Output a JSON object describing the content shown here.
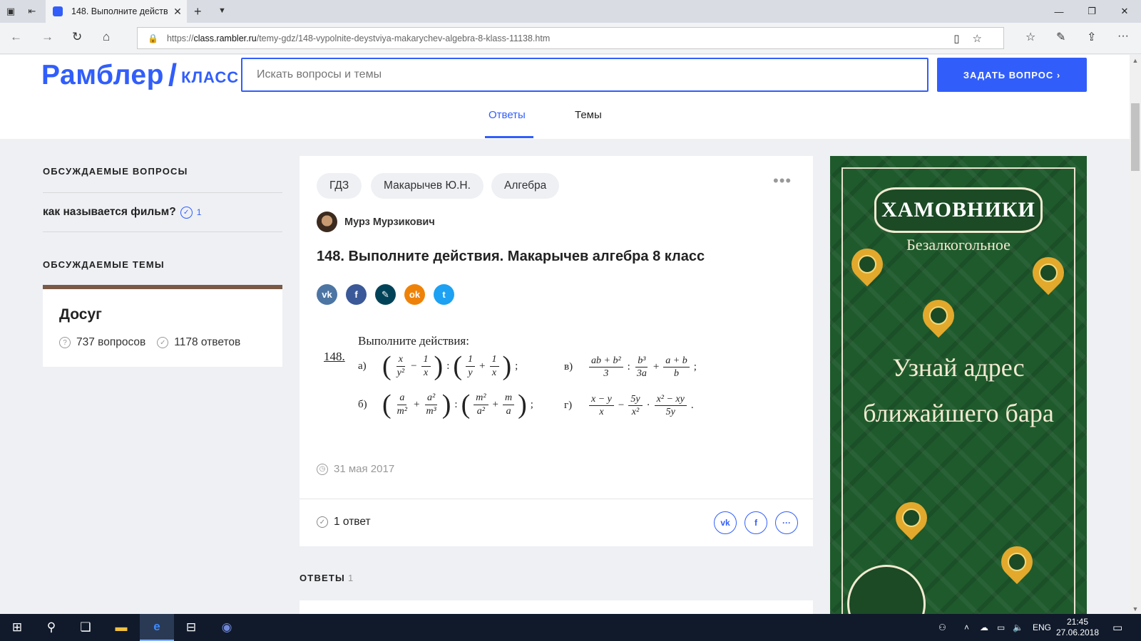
{
  "browser": {
    "tab_title": "148. Выполните действ",
    "url_prefix": "https://",
    "url_host": "class.rambler.ru",
    "url_path": "/temy-gdz/148-vypolnite-deystviya-makarychev-algebra-8-klass-11138.htm"
  },
  "header": {
    "brand": "Рамблер",
    "slash": "/",
    "product": "КЛАСС",
    "search_placeholder": "Искать вопросы и темы",
    "ask_button": "ЗАДАТЬ ВОПРОС ›",
    "tabs": [
      {
        "label": "Ответы",
        "active": true
      },
      {
        "label": "Темы",
        "active": false
      }
    ]
  },
  "sidebar": {
    "discussed_questions_title": "ОБСУЖДАЕМЫЕ ВОПРОСЫ",
    "question": {
      "text": "как называется фильм?",
      "answers": "1"
    },
    "discussed_topics_title": "ОБСУЖДАЕМЫЕ ТЕМЫ",
    "topic": {
      "name": "Досуг",
      "questions": "737 вопросов",
      "answers": "1178 ответов",
      "accent_color": "#7a5a46"
    }
  },
  "question": {
    "tags": [
      "ГДЗ",
      "Макарычев Ю.Н.",
      "Алгебра"
    ],
    "author": "Мурз Мурзикович",
    "title": "148. Выполните действия. Макарычев алгебра 8 класс",
    "share": [
      {
        "icon": "vk-icon",
        "glyph": "vk",
        "color": "#4c75a3"
      },
      {
        "icon": "facebook-icon",
        "glyph": "f",
        "color": "#3b5998"
      },
      {
        "icon": "livejournal-icon",
        "glyph": "✎",
        "color": "#004359"
      },
      {
        "icon": "odnoklassniki-icon",
        "glyph": "ok",
        "color": "#ee8208"
      },
      {
        "icon": "twitter-icon",
        "glyph": "t",
        "color": "#1da1f2"
      }
    ],
    "task": {
      "heading": "Выполните действия:",
      "number": "148.",
      "labels": [
        "а)",
        "б)",
        "в)",
        "г)"
      ]
    },
    "date": "31 мая 2017",
    "answer_count": "1 ответ",
    "footer_share": [
      "vk",
      "f",
      "···"
    ]
  },
  "answers_section": {
    "title": "ОТВЕТЫ",
    "count": "1"
  },
  "ad": {
    "brand": "ХАМОВНИКИ",
    "subtitle": "Безалкогольное",
    "line1": "Узнай адрес",
    "line2": "ближайшего бара",
    "colors": {
      "background": "#1f5a2c",
      "gold": "#e2a92c",
      "cream": "#f2ead1"
    }
  },
  "taskbar": {
    "lang": "ENG",
    "time": "21:45",
    "date": "27.06.2018"
  }
}
